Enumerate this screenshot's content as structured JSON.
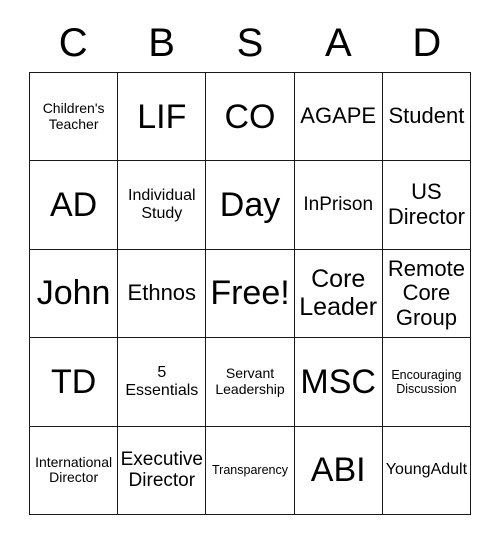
{
  "card": {
    "headers": [
      "C",
      "B",
      "S",
      "A",
      "D"
    ],
    "rows": [
      [
        {
          "text": "Children's Teacher",
          "size": "xxs"
        },
        {
          "text": "LIF",
          "size": "xxl"
        },
        {
          "text": "CO",
          "size": "xxl"
        },
        {
          "text": "AGAPE",
          "size": "md"
        },
        {
          "text": "Student",
          "size": "md"
        }
      ],
      [
        {
          "text": "AD",
          "size": "xxl"
        },
        {
          "text": "Individual Study",
          "size": "xs"
        },
        {
          "text": "Day",
          "size": "xxl"
        },
        {
          "text": "InPrison",
          "size": "sm"
        },
        {
          "text": "US Director",
          "size": "md"
        }
      ],
      [
        {
          "text": "John",
          "size": "xxl"
        },
        {
          "text": "Ethnos",
          "size": "md"
        },
        {
          "text": "Free!",
          "size": "xxl"
        },
        {
          "text": "Core Leader",
          "size": "lg"
        },
        {
          "text": "Remote Core Group",
          "size": "md"
        }
      ],
      [
        {
          "text": "TD",
          "size": "xxl"
        },
        {
          "text": "5 Essentials",
          "size": "xs"
        },
        {
          "text": "Servant Leadership",
          "size": "xxs"
        },
        {
          "text": "MSC",
          "size": "xxl"
        },
        {
          "text": "Encouraging Discussion",
          "size": "tiny"
        }
      ],
      [
        {
          "text": "International Director",
          "size": "xxs"
        },
        {
          "text": "Executive Director",
          "size": "sm"
        },
        {
          "text": "Transparency",
          "size": "tiny"
        },
        {
          "text": "ABI",
          "size": "xxl"
        },
        {
          "text": "YoungAdult",
          "size": "xs"
        }
      ]
    ],
    "free_space": {
      "row": 2,
      "col": 2,
      "label": "Free!"
    },
    "colors": {
      "background": "#ffffff",
      "border": "#1a1a1a",
      "text": "#000000"
    }
  }
}
